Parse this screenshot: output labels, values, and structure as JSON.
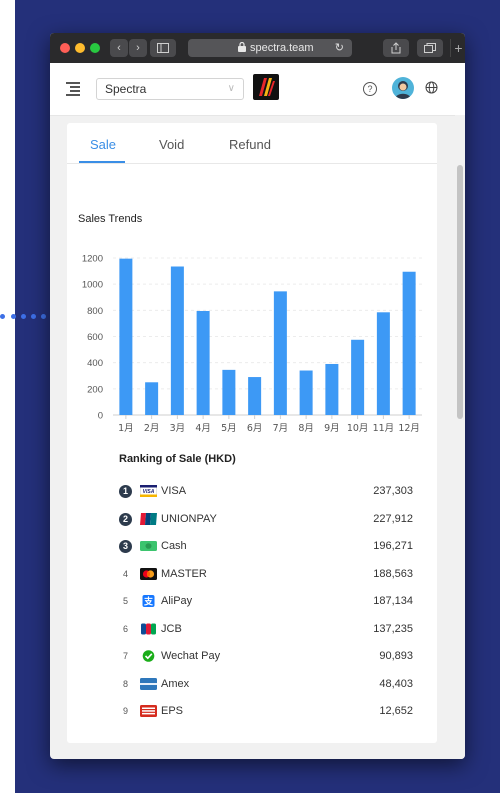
{
  "browser": {
    "url": "spectra.team",
    "back_glyph": "‹",
    "forward_glyph": "›",
    "new_tab_glyph": "+"
  },
  "header": {
    "merchant_select": "Spectra",
    "select_chevron": "∨",
    "help_glyph": "?"
  },
  "tabs": [
    {
      "label": "Sale",
      "active": true
    },
    {
      "label": "Void",
      "active": false
    },
    {
      "label": "Refund",
      "active": false
    }
  ],
  "chart_data": {
    "type": "bar",
    "title": "Sales Trends",
    "categories": [
      "1月",
      "2月",
      "3月",
      "4月",
      "5月",
      "6月",
      "7月",
      "8月",
      "9月",
      "10月",
      "11月",
      "12月"
    ],
    "values": [
      1195,
      250,
      1135,
      795,
      345,
      290,
      945,
      340,
      390,
      575,
      785,
      1095
    ],
    "ylim": [
      0,
      1200
    ],
    "yticks": [
      0,
      200,
      400,
      600,
      800,
      1000,
      1200
    ],
    "bar_color": "#3d99f5",
    "grid": true
  },
  "ranking": {
    "title": "Ranking of Sale (HKD)",
    "items": [
      {
        "rank": "1",
        "name": "VISA",
        "amount": "237,303",
        "icon": "visa-icon"
      },
      {
        "rank": "2",
        "name": "UNIONPAY",
        "amount": "227,912",
        "icon": "unionpay-icon"
      },
      {
        "rank": "3",
        "name": "Cash",
        "amount": "196,271",
        "icon": "cash-icon"
      },
      {
        "rank": "4",
        "name": "MASTER",
        "amount": "188,563",
        "icon": "mastercard-icon"
      },
      {
        "rank": "5",
        "name": "AliPay",
        "amount": "187,134",
        "icon": "alipay-icon"
      },
      {
        "rank": "6",
        "name": "JCB",
        "amount": "137,235",
        "icon": "jcb-icon"
      },
      {
        "rank": "7",
        "name": "Wechat Pay",
        "amount": "90,893",
        "icon": "wechat-pay-icon"
      },
      {
        "rank": "8",
        "name": "Amex",
        "amount": "48,403",
        "icon": "amex-icon"
      },
      {
        "rank": "9",
        "name": "EPS",
        "amount": "12,652",
        "icon": "eps-icon"
      }
    ]
  },
  "colors": {
    "accent": "#3a8ee6",
    "background": "#24307a"
  }
}
